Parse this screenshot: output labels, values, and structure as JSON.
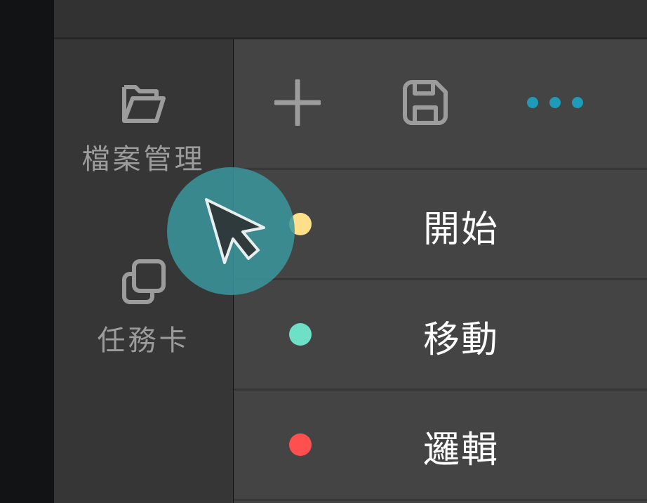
{
  "sidebar": {
    "items": [
      {
        "label": "檔案管理",
        "icon": "folder-open-icon"
      },
      {
        "label": "任務卡",
        "icon": "copy-cards-icon"
      }
    ]
  },
  "toolbar": {
    "add_icon": "plus-icon",
    "save_icon": "floppy-disk-icon",
    "more_icon": "more-dots-icon",
    "accent_color": "#1f9bb8"
  },
  "blocks": [
    {
      "label": "開始",
      "color": "#ffe08a"
    },
    {
      "label": "移動",
      "color": "#6fe0c8"
    },
    {
      "label": "邏輯",
      "color": "#ff4f4f"
    }
  ],
  "cursor": {
    "icon": "pointer-cursor-icon",
    "halo_color": "#3a969e"
  }
}
